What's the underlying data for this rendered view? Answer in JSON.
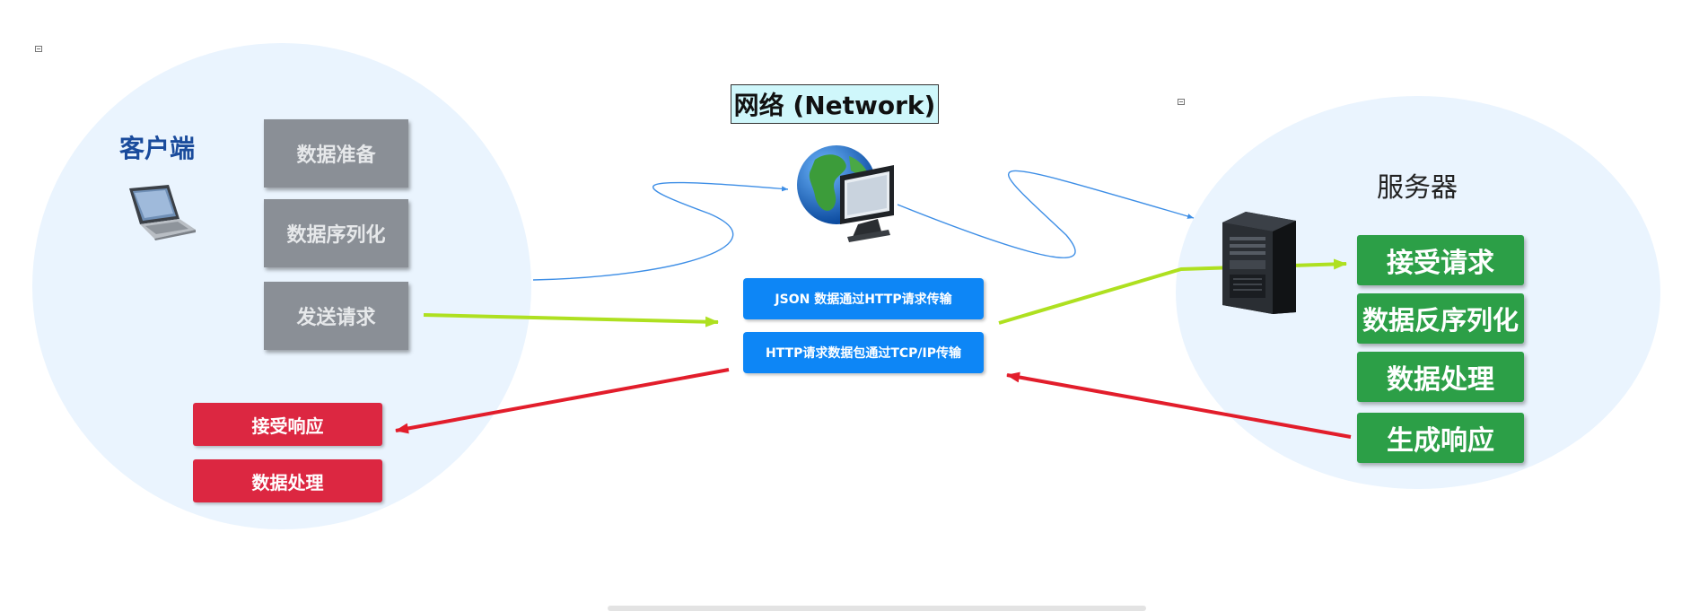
{
  "client": {
    "title": "客户端",
    "steps": [
      "数据准备",
      "数据序列化",
      "发送请求"
    ],
    "response_steps": [
      "接受响应",
      "数据处理"
    ]
  },
  "network": {
    "title": "网络 (Network)",
    "transports": [
      "JSON 数据通过HTTP请求传输",
      "HTTP请求数据包通过TCP/IP传输"
    ]
  },
  "server": {
    "title": "服务器",
    "steps": [
      "接受请求",
      "数据反序列化",
      "数据处理",
      "生成响应"
    ]
  },
  "icons": {
    "client_device": "laptop-icon",
    "network_device": "globe-computer-icon",
    "server_device": "server-tower-icon"
  },
  "colors": {
    "ellipse": "#eaf4fe",
    "client_step": "#8a8f96",
    "response": "#dc2741",
    "transport": "#0d86f6",
    "server_step": "#2c9f47",
    "request_arrow": "#aee020",
    "response_arrow": "#e21d2b",
    "network_line": "#3d8ee6"
  }
}
